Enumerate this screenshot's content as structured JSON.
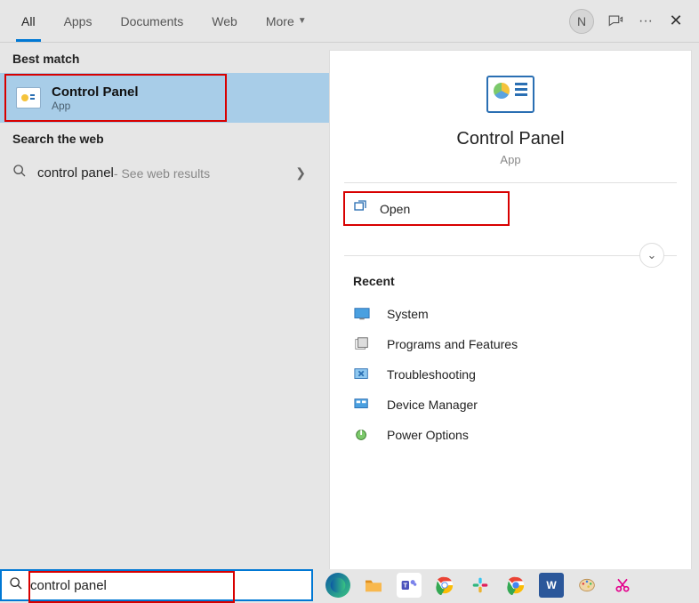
{
  "tabs": [
    "All",
    "Apps",
    "Documents",
    "Web",
    "More"
  ],
  "avatar_letter": "N",
  "left": {
    "best_match_label": "Best match",
    "best_match": {
      "title": "Control Panel",
      "subtitle": "App"
    },
    "search_web_label": "Search the web",
    "web_result": {
      "term": "control panel",
      "suffix": " - See web results"
    }
  },
  "right": {
    "hero": {
      "title": "Control Panel",
      "subtitle": "App"
    },
    "open_label": "Open",
    "recent_label": "Recent",
    "recent": [
      "System",
      "Programs and Features",
      "Troubleshooting",
      "Device Manager",
      "Power Options"
    ]
  },
  "search_value": "control panel"
}
